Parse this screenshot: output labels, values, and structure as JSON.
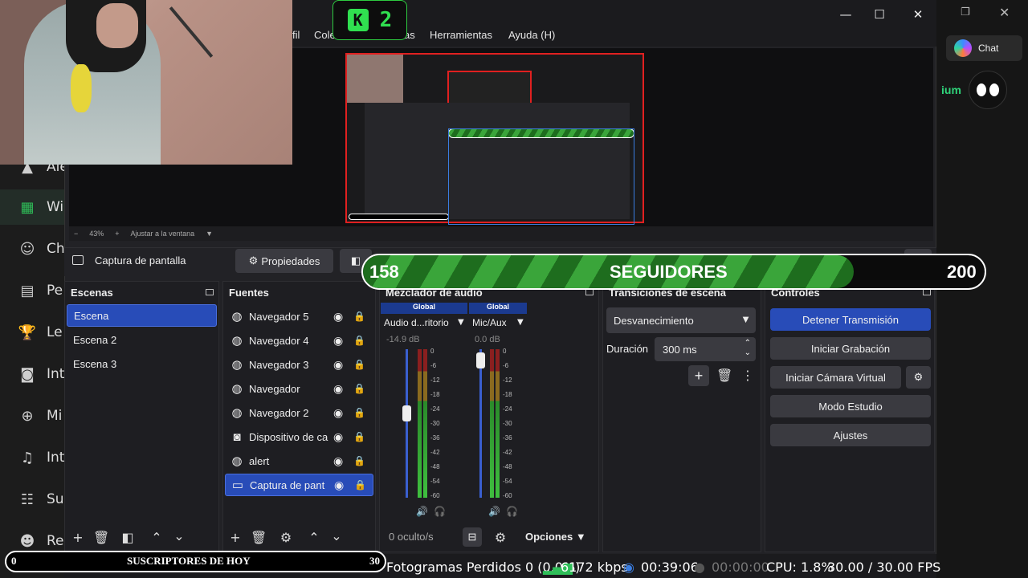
{
  "background_app": {
    "nav_items": [
      {
        "label": "Ale",
        "icon": "alert-icon"
      },
      {
        "label": "Wi",
        "icon": "widgets-icon"
      },
      {
        "label": "Ch",
        "icon": "chatbot-icon"
      },
      {
        "label": "Pe",
        "icon": "profile-card-icon"
      },
      {
        "label": "Le",
        "icon": "trophy-icon"
      },
      {
        "label": "Int",
        "icon": "discord-icon"
      },
      {
        "label": "Mi",
        "icon": "gamepad-icon"
      },
      {
        "label": "Int",
        "icon": "music-icon"
      },
      {
        "label": "Su",
        "icon": "group-icon"
      },
      {
        "label": "Re",
        "icon": "users-icon"
      }
    ],
    "active_color": "#2fbf59"
  },
  "right_app": {
    "chat_label": "Chat",
    "partial_text": "ium"
  },
  "kick_badge": {
    "count": "2"
  },
  "obs": {
    "menu": [
      "fil",
      "Cole",
      "as",
      "Herramientas",
      "Ayuda (H)"
    ],
    "preview": {
      "zoom": "43%",
      "fit_label": "Ajustar a la ventana"
    },
    "source_bar": {
      "selected_source": "Captura de pantalla",
      "properties_label": "Propiedades"
    },
    "scenes": {
      "title": "Escenas",
      "items": [
        "Escena",
        "Escena 2",
        "Escena 3"
      ],
      "selected_index": 0
    },
    "sources": {
      "title": "Fuentes",
      "items": [
        {
          "label": "Navegador 5",
          "icon": "globe-icon"
        },
        {
          "label": "Navegador 4",
          "icon": "globe-icon"
        },
        {
          "label": "Navegador 3",
          "icon": "globe-icon"
        },
        {
          "label": "Navegador",
          "icon": "globe-icon"
        },
        {
          "label": "Navegador 2",
          "icon": "globe-icon"
        },
        {
          "label": "Dispositivo de ca",
          "icon": "camera-icon"
        },
        {
          "label": "alert",
          "icon": "globe-icon"
        },
        {
          "label": "Captura de pant",
          "icon": "monitor-icon"
        }
      ],
      "selected_index": 7
    },
    "mixer": {
      "title": "Mezclador de audio",
      "channels": [
        {
          "badge": "Global",
          "name": "Audio d...ritorio",
          "db": "-14.9 dB",
          "level": 0.62
        },
        {
          "badge": "Global",
          "name": "Mic/Aux",
          "db": "0.0 dB",
          "level": 0.98
        }
      ],
      "ticks": [
        "0",
        "-6",
        "-12",
        "-18",
        "-24",
        "-30",
        "-36",
        "-42",
        "-48",
        "-54",
        "-60"
      ],
      "hidden_label": "0 oculto/s",
      "options_label": "Opciones"
    },
    "transitions": {
      "title": "Transiciones de escena",
      "selected": "Desvanecimiento",
      "duration_label": "Duración",
      "duration_value": "300 ms"
    },
    "controls": {
      "title": "Controles",
      "stop_stream": "Detener Transmisión",
      "start_recording": "Iniciar Grabación",
      "start_virtual_cam": "Iniciar Cámara Virtual",
      "studio_mode": "Modo Estudio",
      "settings": "Ajustes",
      "accent": "#284cb8"
    },
    "status": {
      "dropped_frames": "Fotogramas Perdidos 0 (0.0%)",
      "bitrate": "6172 kbps",
      "stream_time": "00:39:06",
      "rec_time": "00:00:00",
      "cpu": "CPU: 1.8%",
      "fps": "30.00 / 30.00 FPS"
    }
  },
  "goal_overlay": {
    "current": "158",
    "label": "SEGUIDORES",
    "target": "200",
    "fraction": 0.79,
    "stripe_colors": [
      "#1e6d1e",
      "#3aa53a"
    ]
  },
  "subs_overlay": {
    "current": "0",
    "label": "SUSCRIPTORES DE HOY",
    "target": "30"
  }
}
